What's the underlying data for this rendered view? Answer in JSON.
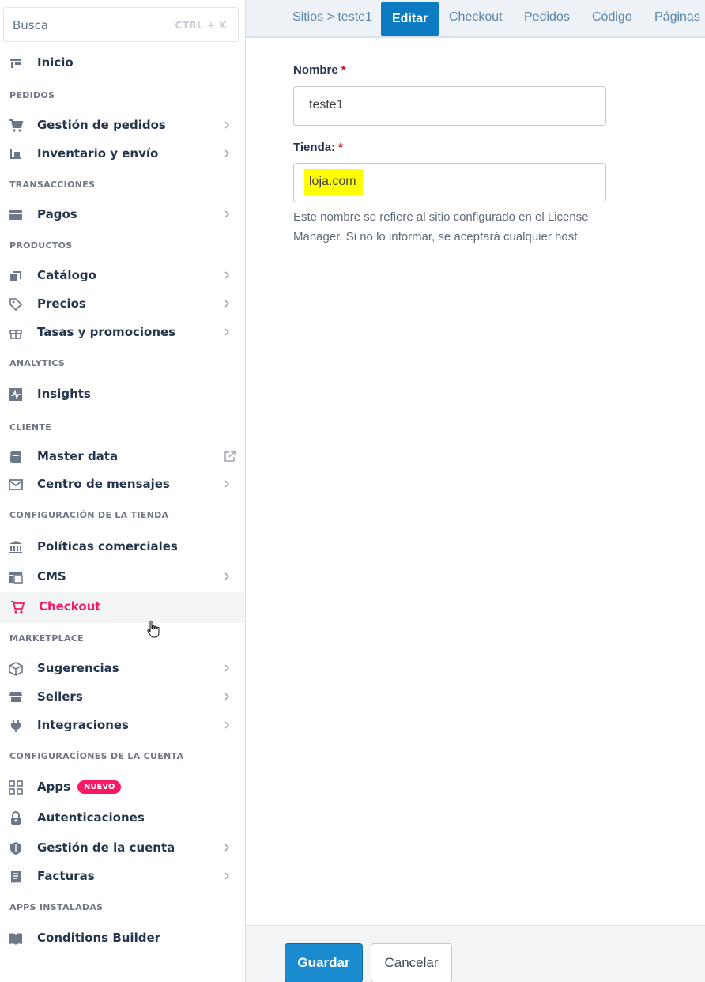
{
  "search": {
    "placeholder": "Busca",
    "shortcut": "CTRL + K"
  },
  "sidebar": {
    "home": {
      "label": "Inicio",
      "icon": "store-icon"
    },
    "sections": [
      {
        "title": "PEDIDOS",
        "items": [
          {
            "label": "Gestión de pedidos",
            "icon": "cart-icon",
            "chevron": true
          },
          {
            "label": "Inventario y envío",
            "icon": "forklift-icon",
            "chevron": true
          }
        ]
      },
      {
        "title": "TRANSACCIONES",
        "items": [
          {
            "label": "Pagos",
            "icon": "card-icon",
            "chevron": true
          }
        ]
      },
      {
        "title": "PRODUCTOS",
        "items": [
          {
            "label": "Catálogo",
            "icon": "catalog-icon",
            "chevron": true
          },
          {
            "label": "Precios",
            "icon": "tag-icon",
            "chevron": true
          },
          {
            "label": "Tasas y promociones",
            "icon": "gift-icon",
            "chevron": true
          }
        ]
      },
      {
        "title": "ANALYTICS",
        "items": [
          {
            "label": "Insights",
            "icon": "pulse-icon",
            "chevron": false
          }
        ]
      },
      {
        "title": "CLIENTE",
        "items": [
          {
            "label": "Master data",
            "icon": "database-icon",
            "external": true
          },
          {
            "label": "Centro de mensajes",
            "icon": "mail-icon",
            "chevron": true
          }
        ]
      },
      {
        "title": "CONFIGURACIÓN DE LA TIENDA",
        "items": [
          {
            "label": "Políticas comerciales",
            "icon": "bank-icon",
            "chevron": false
          },
          {
            "label": "CMS",
            "icon": "layout-icon",
            "chevron": true
          },
          {
            "label": "Checkout",
            "icon": "cart-icon",
            "chevron": false,
            "active": true
          }
        ]
      },
      {
        "title": "MARKETPLACE",
        "items": [
          {
            "label": "Sugerencias",
            "icon": "box-icon",
            "chevron": true
          },
          {
            "label": "Sellers",
            "icon": "shop-icon",
            "chevron": true
          },
          {
            "label": "Integraciones",
            "icon": "plug-icon",
            "chevron": true
          }
        ]
      },
      {
        "title": "CONFIGURACÍONES DE LA CUENTA",
        "items": [
          {
            "label": "Apps",
            "icon": "grid-icon",
            "badge": "NUEVO"
          },
          {
            "label": "Autenticaciones",
            "icon": "lock-icon",
            "chevron": false
          },
          {
            "label": "Gestión de la cuenta",
            "icon": "shield-icon",
            "chevron": true
          },
          {
            "label": "Facturas",
            "icon": "invoice-icon",
            "chevron": true
          }
        ]
      },
      {
        "title": "APPS INSTALADAS",
        "items": [
          {
            "label": "Conditions Builder",
            "icon": "book-icon",
            "chevron": false
          }
        ]
      }
    ]
  },
  "topnav": {
    "breadcrumb": "Sitios > teste1",
    "tabs": [
      "Editar",
      "Checkout",
      "Pedidos",
      "Código",
      "Páginas"
    ],
    "active_tab": "Editar"
  },
  "form": {
    "name_label": "Nombre",
    "name_value": "teste1",
    "store_label": "Tienda:",
    "store_value": "loja.com",
    "required_mark": "*",
    "help": "Este nombre se refiere al sitio configurado en el License Manager. Si no lo informar, se aceptará cualquier host"
  },
  "footer": {
    "save": "Guardar",
    "cancel": "Cancelar"
  },
  "colors": {
    "accent": "#f71963",
    "primary": "#0c7bc1",
    "highlight": "#ffff00"
  }
}
